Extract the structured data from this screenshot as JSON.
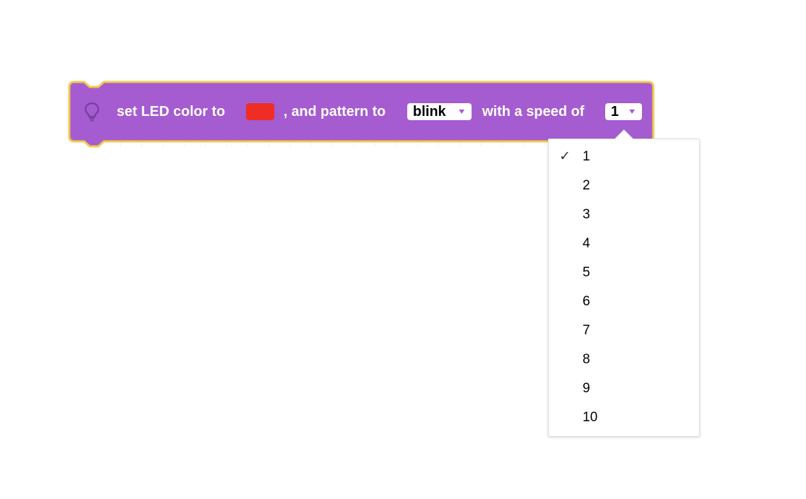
{
  "block": {
    "color": "#a55cd0",
    "border_color": "#f2c94c",
    "label_set": "set LED color to",
    "led_color": "#ee2e24",
    "label_pattern": ", and pattern to",
    "pattern_value": "blink",
    "label_speed": "with a speed of",
    "speed_value": "1",
    "icon": "lightbulb-icon"
  },
  "speed_menu": {
    "selected": "1",
    "check_glyph": "✓",
    "options": [
      "1",
      "2",
      "3",
      "4",
      "5",
      "6",
      "7",
      "8",
      "9",
      "10"
    ]
  }
}
